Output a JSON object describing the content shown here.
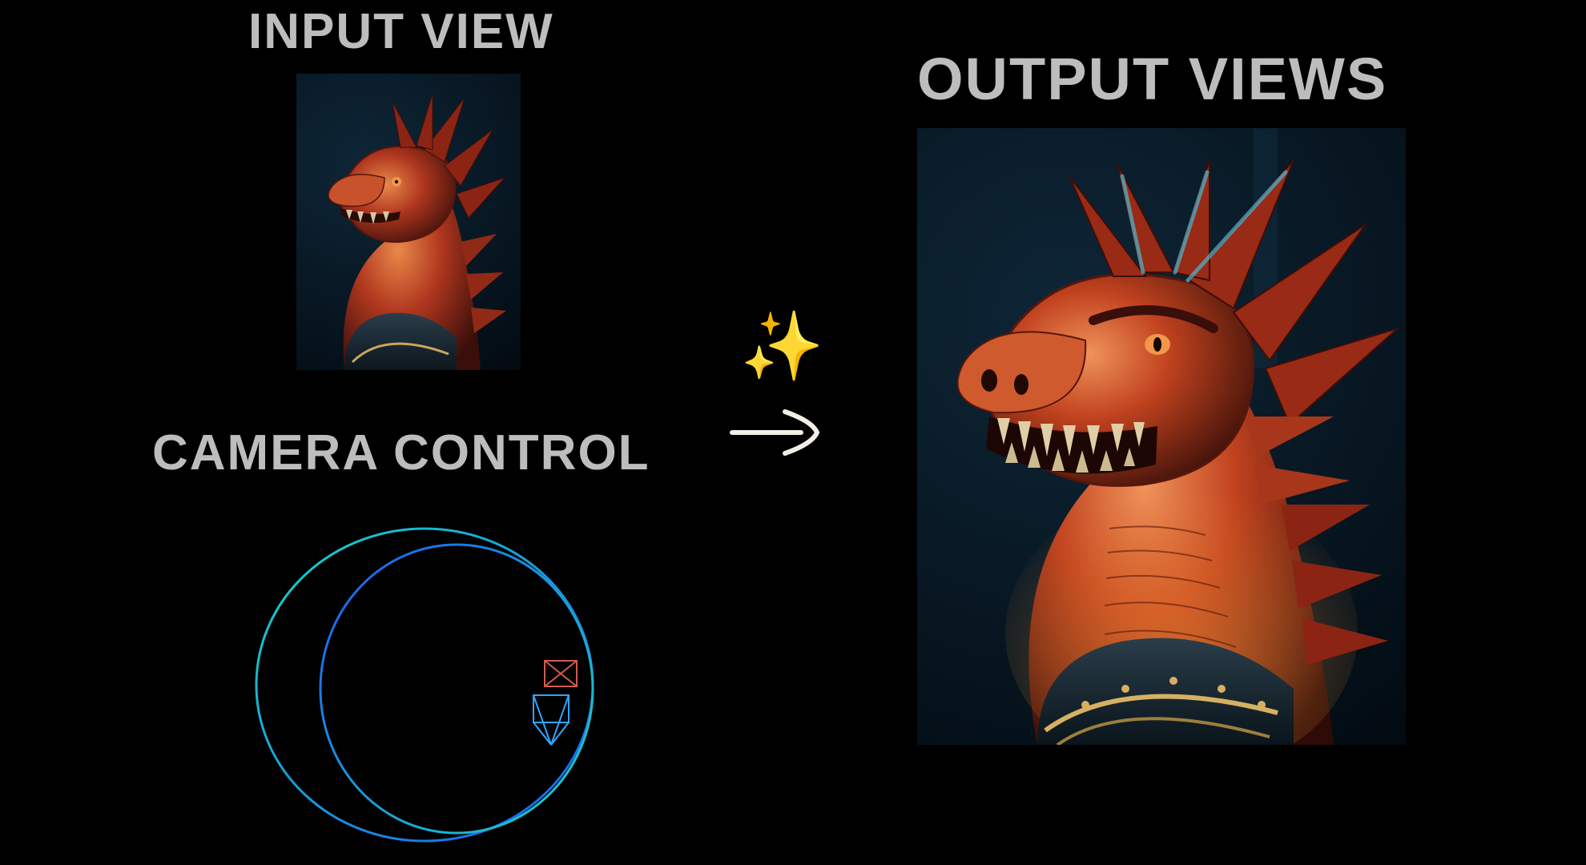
{
  "headings": {
    "input": "INPUT VIEW",
    "camera": "CAMERA CONTROL",
    "output": "OUTPUT VIEWS"
  },
  "icons": {
    "sparkles": "✨",
    "arrow": "→"
  },
  "subject": {
    "description": "Red dragon head portrait",
    "base_color": "#b0371f",
    "highlight_color": "#e9894a",
    "shadow_color": "#3a0e0a",
    "eye_color": "#f2974a",
    "teeth_color": "#d7c7a1",
    "armor_color": "#1f2e38"
  },
  "camera_control": {
    "path_kind": "dual orbit rings",
    "ring1_color": "#17d6c4",
    "ring2_color": "#1d5af3",
    "frustum_input_color": "#d25a4e",
    "frustum_output_color": "#2fa6ff"
  }
}
